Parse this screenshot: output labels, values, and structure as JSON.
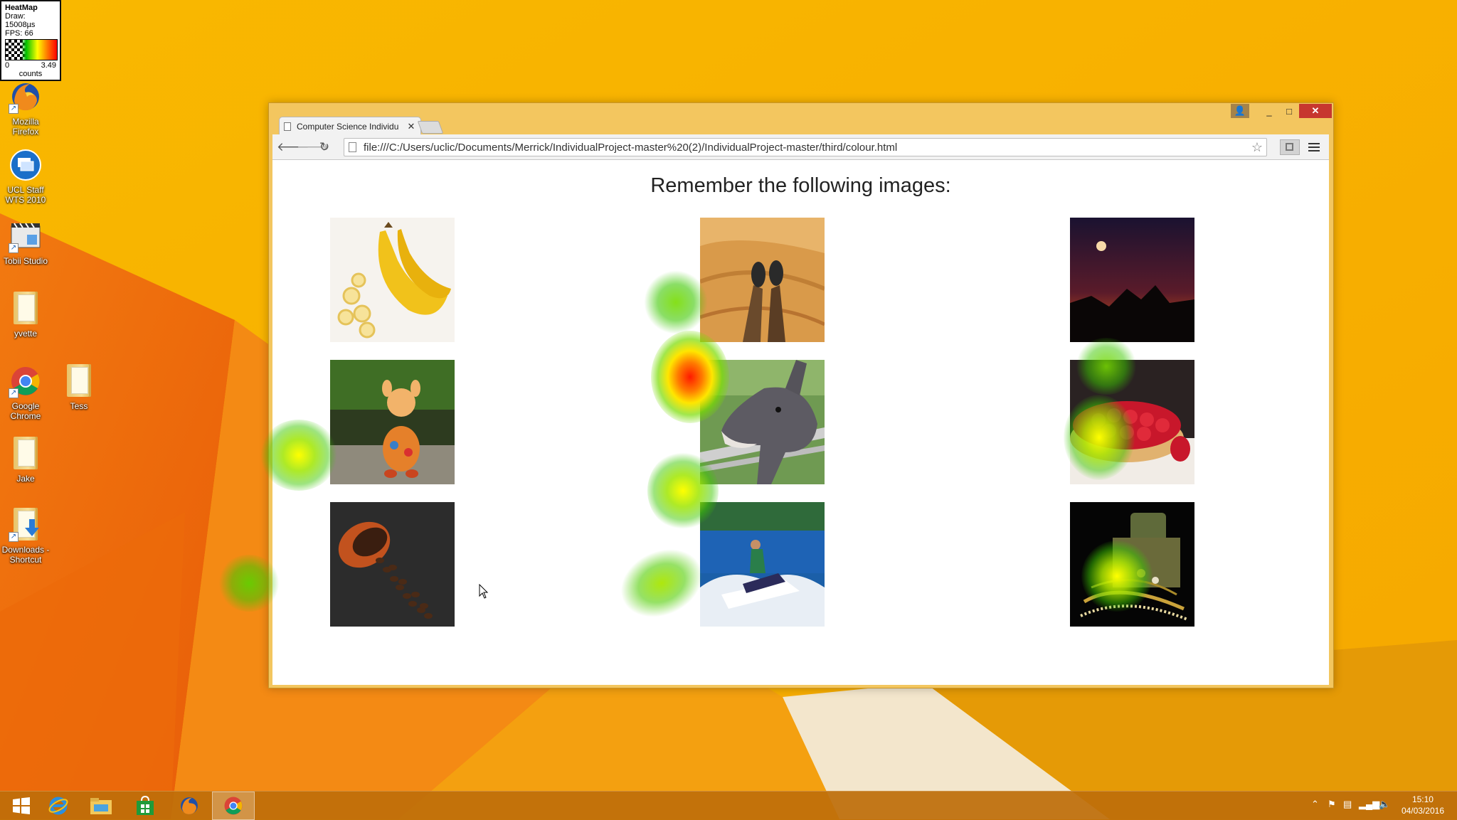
{
  "heatmap_legend": {
    "title": "HeatMap",
    "draw": "Draw: 15008µs",
    "fps": "FPS: 66",
    "min": "0",
    "max": "3.49",
    "unit": "counts"
  },
  "desktop": {
    "icons": [
      {
        "label": "Mozilla Firefox",
        "icon": "firefox-icon"
      },
      {
        "label": "UCL Staff WTS 2010",
        "icon": "remote-desktop-icon"
      },
      {
        "label": "Tobii Studio",
        "icon": "tobii-studio-icon"
      },
      {
        "label": "yvette",
        "icon": "folder-icon"
      },
      {
        "label": "Google Chrome",
        "icon": "chrome-icon"
      },
      {
        "label": "Tess",
        "icon": "folder-icon"
      },
      {
        "label": "Jake",
        "icon": "folder-icon"
      },
      {
        "label": "Downloads - Shortcut",
        "icon": "downloads-folder-icon"
      }
    ]
  },
  "browser": {
    "tab_title": "Computer Science Individu",
    "url": "file:///C:/Users/uclic/Documents/Merrick/IndividualProject-master%20(2)/IndividualProject-master/third/colour.html"
  },
  "page": {
    "heading": "Remember the following images:",
    "images": [
      "bananas",
      "desert-boots",
      "moon-sunset",
      "toy-giraffe",
      "donkey",
      "strawberry-tart",
      "coffee-beans",
      "jet-ski",
      "jewellery-box"
    ]
  },
  "taskbar": {
    "items": [
      "start-button",
      "internet-explorer",
      "file-explorer",
      "store",
      "firefox",
      "chrome"
    ],
    "active": "chrome",
    "time": "15:10",
    "date": "04/03/2016"
  },
  "colors": {
    "wallpaper": "#f7b100",
    "window_frame": "#f3c65f",
    "close_button": "#c7372f"
  }
}
